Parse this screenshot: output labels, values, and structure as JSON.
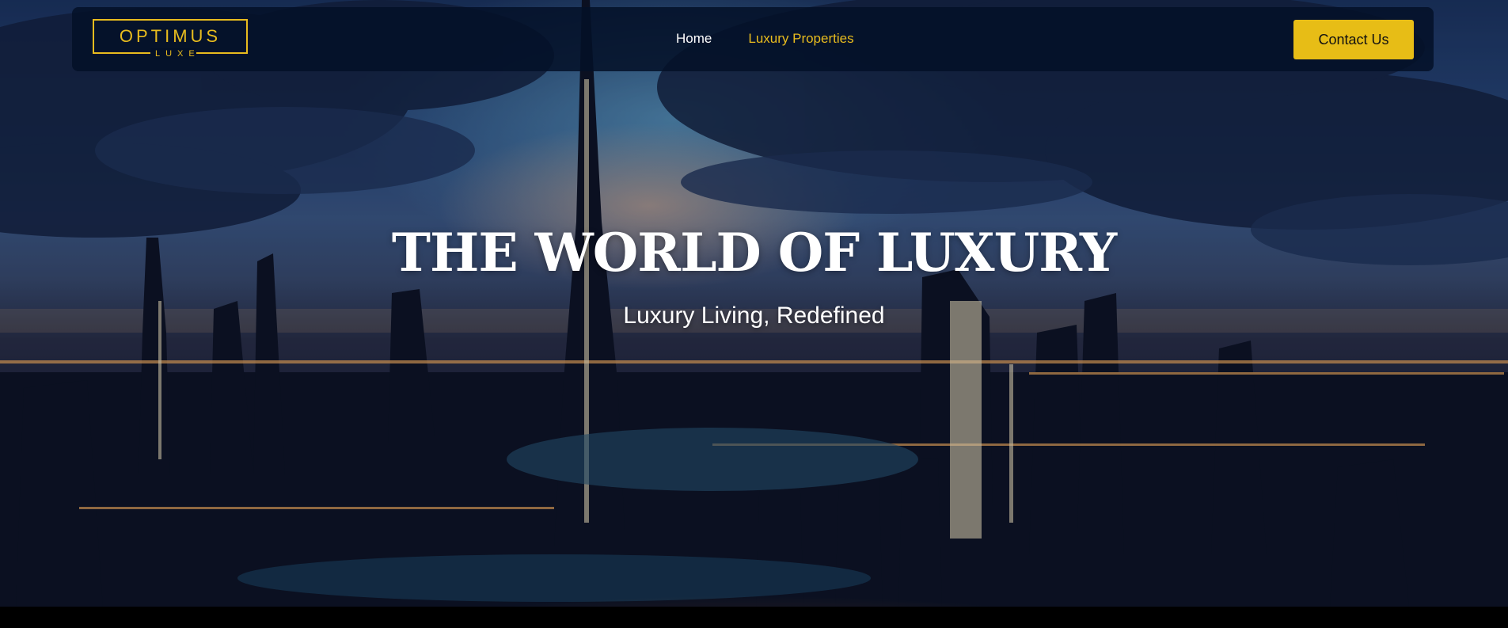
{
  "brand": {
    "name": "OPTIMUS",
    "tagline": "LUXE",
    "accent_color": "#e8bc1e"
  },
  "nav": {
    "links": [
      {
        "label": "Home",
        "active": false
      },
      {
        "label": "Luxury Properties",
        "active": true
      }
    ],
    "cta_label": "Contact Us"
  },
  "hero": {
    "title": "THE WORLD OF LUXURY",
    "subtitle": "Luxury Living, Redefined",
    "background": "city-skyline-night-photo"
  }
}
